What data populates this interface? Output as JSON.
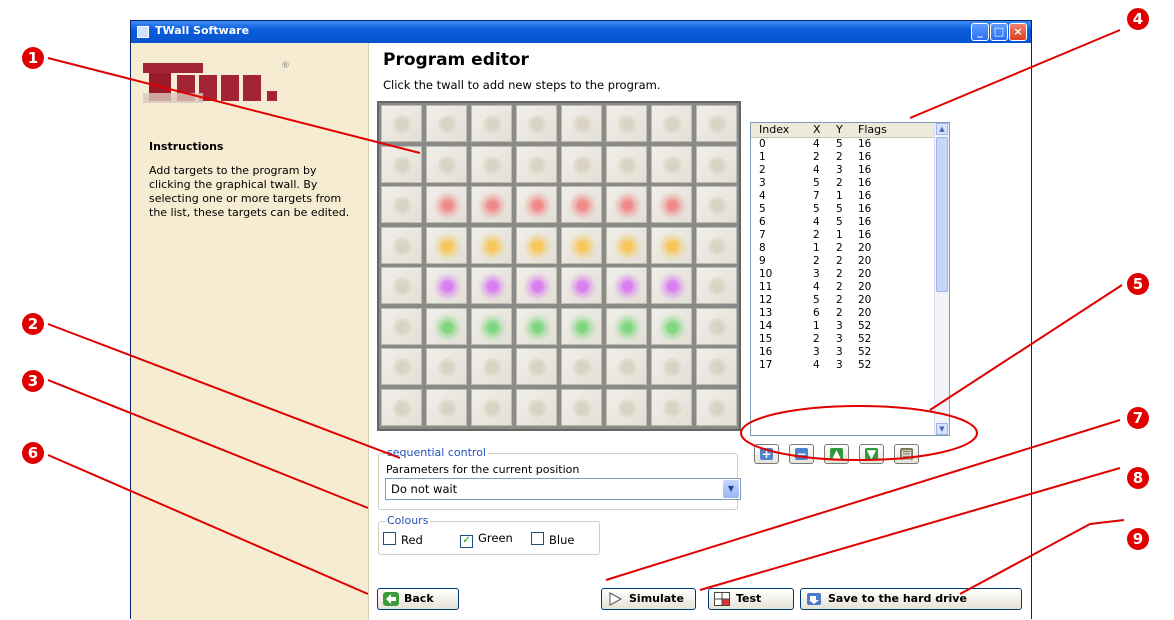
{
  "window": {
    "title": "TWall Software",
    "controls": [
      "_",
      "□",
      "×"
    ]
  },
  "sidebar": {
    "logo_text": "twall",
    "logo_mark": "®",
    "instructions_title": "Instructions",
    "instructions_text": "Add targets to the program by clicking the graphical twall. By selecting one or more targets from the list, these targets can be edited."
  },
  "main": {
    "title": "Program editor",
    "subtitle": "Click the twall to add new steps to the program."
  },
  "twall": {
    "columns": 8,
    "rows": 8,
    "lit_rows": [
      {
        "row": 3,
        "color": "#f08a8a"
      },
      {
        "row": 4,
        "color": "#f6c75a"
      },
      {
        "row": 5,
        "color": "#d97df0"
      },
      {
        "row": 6,
        "color": "#7fd87f"
      }
    ],
    "lit_columns": [
      2,
      3,
      4,
      5,
      6,
      7
    ]
  },
  "program_table": {
    "headers": [
      "Index",
      "X",
      "Y",
      "Flags"
    ],
    "rows": [
      [
        "0",
        "4",
        "5",
        "16"
      ],
      [
        "1",
        "2",
        "2",
        "16"
      ],
      [
        "2",
        "4",
        "3",
        "16"
      ],
      [
        "3",
        "5",
        "2",
        "16"
      ],
      [
        "4",
        "7",
        "1",
        "16"
      ],
      [
        "5",
        "5",
        "5",
        "16"
      ],
      [
        "6",
        "4",
        "5",
        "16"
      ],
      [
        "7",
        "2",
        "1",
        "16"
      ],
      [
        "8",
        "1",
        "2",
        "20"
      ],
      [
        "9",
        "2",
        "2",
        "20"
      ],
      [
        "10",
        "3",
        "2",
        "20"
      ],
      [
        "11",
        "4",
        "2",
        "20"
      ],
      [
        "12",
        "5",
        "2",
        "20"
      ],
      [
        "13",
        "6",
        "2",
        "20"
      ],
      [
        "14",
        "1",
        "3",
        "52"
      ],
      [
        "15",
        "2",
        "3",
        "52"
      ],
      [
        "16",
        "3",
        "3",
        "52"
      ],
      [
        "17",
        "4",
        "3",
        "52"
      ]
    ]
  },
  "table_tools": [
    {
      "name": "add-icon",
      "glyph": "+"
    },
    {
      "name": "remove-icon",
      "glyph": "−"
    },
    {
      "name": "move-up-icon",
      "glyph": "▲"
    },
    {
      "name": "move-down-icon",
      "glyph": "▼"
    },
    {
      "name": "delete-bin-icon",
      "glyph": "▤"
    }
  ],
  "sequential_control": {
    "legend": "sequential control",
    "label": "Parameters for the current position",
    "selected": "Do not wait"
  },
  "colours": {
    "legend": "Colours",
    "options": [
      {
        "label": "Red",
        "checked": false
      },
      {
        "label": "Green",
        "checked": true
      },
      {
        "label": "Blue",
        "checked": false
      }
    ]
  },
  "buttons": {
    "back": "Back",
    "simulate": "Simulate",
    "test": "Test",
    "save": "Save to the hard drive"
  },
  "callouts": [
    "1",
    "2",
    "3",
    "4",
    "5",
    "6",
    "7",
    "8",
    "9"
  ],
  "accent_color": "#e00000"
}
